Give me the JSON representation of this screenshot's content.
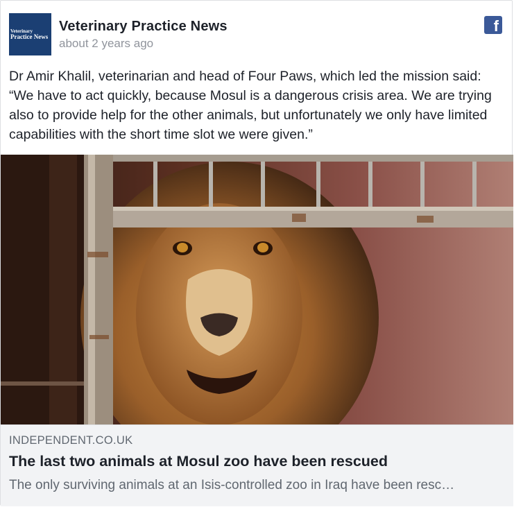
{
  "post": {
    "page_name": "Veterinary Practice News",
    "timestamp": "about 2 years ago",
    "avatar": {
      "line1": "Veterinary",
      "line2": "Practice News"
    },
    "platform_icon": "facebook-icon",
    "text": "Dr Amir Khalil, veterinarian and head of Four Paws, which led the mission said: “We have to act quickly, because Mosul is a dangerous crisis area. We are trying also to provide help for the other animals, but unfortunately we only have limited capabilities with the short time slot we were given.”"
  },
  "link": {
    "domain": "INDEPENDENT.CO.UK",
    "title": "The last two animals at Mosul zoo have been rescued",
    "description": "The only surviving animals at an Isis-controlled zoo in Iraq have been resc…"
  },
  "colors": {
    "brand_blue": "#3b5998",
    "avatar_bg": "#1b3f73",
    "meta_gray": "#90949c",
    "link_bg": "#f2f3f5"
  }
}
